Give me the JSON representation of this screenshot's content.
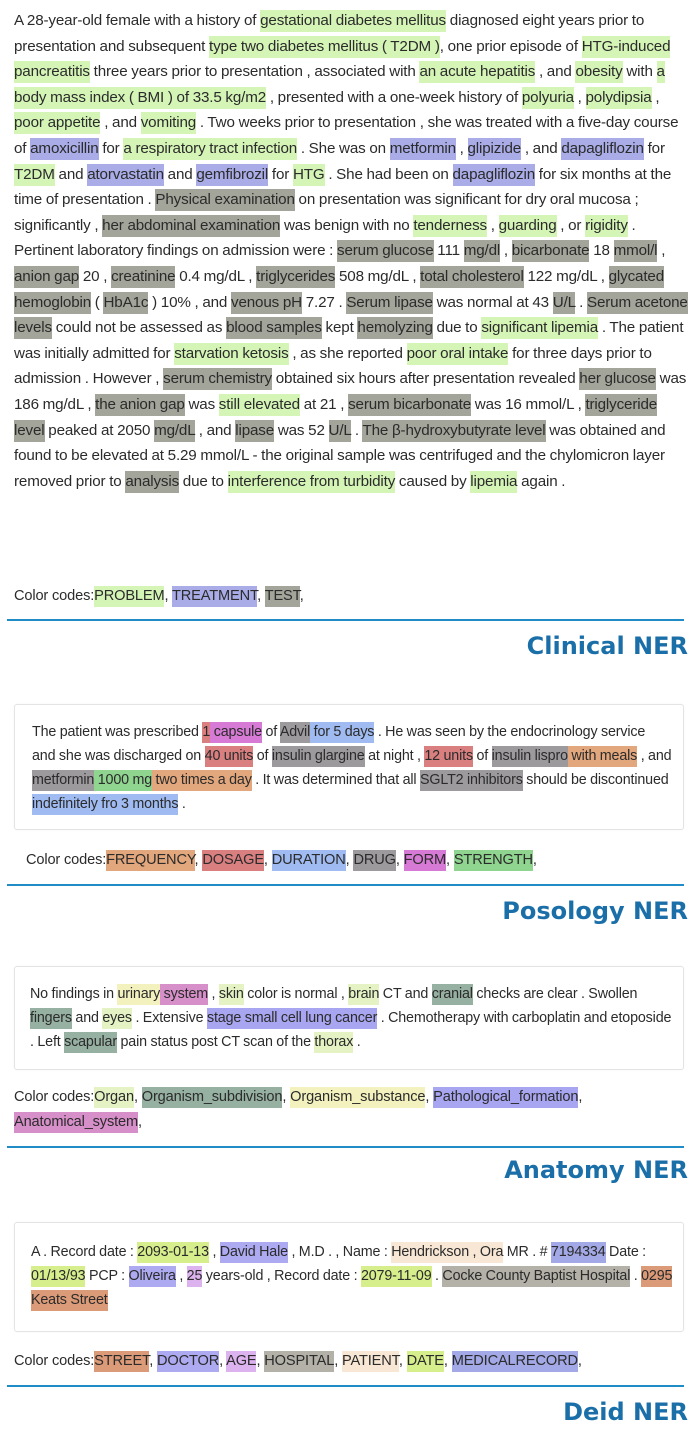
{
  "colors": {
    "PROBLEM": "#d5f5b7",
    "TREATMENT": "#a9ace7",
    "TEST": "#a3a59a",
    "FREQUENCY": "#e2a77c",
    "DOSAGE": "#d97f80",
    "DURATION": "#9fbbf1",
    "DRUG": "#9d9a9e",
    "FORM": "#d67ad5",
    "STRENGTH": "#8fd48f",
    "Organ": "#e5f3c4",
    "Organism_subdivision": "#96b0a2",
    "Organism_substance": "#f3f2bf",
    "Pathological_formation": "#a9a6f1",
    "Anatomical_system": "#d78fc9",
    "STREET": "#dc9b78",
    "DOCTOR": "#aeaaf2",
    "AGE": "#dcb3ee",
    "HOSPITAL": "#b4b1a8",
    "PATIENT": "#f8e7d4",
    "DATE": "#d6ee8c",
    "MEDICALRECORD": "#a2a9e6",
    "rule": "#1f8cc5",
    "title": "#1b6fa8"
  },
  "sections": [
    {
      "id": "clinical",
      "title": "Clinical NER",
      "legend_prefix": "Color codes:",
      "legend": [
        "PROBLEM",
        "TREATMENT",
        "TEST"
      ],
      "tokens": [
        [
          "A 28-year-old female with a history of ",
          null
        ],
        [
          "gestational diabetes mellitus",
          "PROBLEM"
        ],
        [
          " diagnosed eight years prior to presentation and subsequent ",
          null
        ],
        [
          "type two diabetes mellitus ( T2DM )",
          "PROBLEM"
        ],
        [
          ", one prior episode of ",
          null
        ],
        [
          "HTG-induced pancreatitis",
          "PROBLEM"
        ],
        [
          " three years prior to presentation , associated with ",
          null
        ],
        [
          "an acute hepatitis",
          "PROBLEM"
        ],
        [
          " , and ",
          null
        ],
        [
          "obesity",
          "PROBLEM"
        ],
        [
          " with ",
          null
        ],
        [
          "a body mass index ( BMI ) of 33.5 kg/m2",
          "PROBLEM"
        ],
        [
          " , presented with a one-week history of ",
          null
        ],
        [
          "polyuria",
          "PROBLEM"
        ],
        [
          " , ",
          null
        ],
        [
          "polydipsia",
          "PROBLEM"
        ],
        [
          " , ",
          null
        ],
        [
          "poor appetite",
          "PROBLEM"
        ],
        [
          " , and ",
          null
        ],
        [
          "vomiting",
          "PROBLEM"
        ],
        [
          " . Two weeks prior to presentation , she was treated with a five-day course of ",
          null
        ],
        [
          "amoxicillin",
          "TREATMENT"
        ],
        [
          " for ",
          null
        ],
        [
          "a respiratory tract infection",
          "PROBLEM"
        ],
        [
          " . She was on ",
          null
        ],
        [
          "metformin",
          "TREATMENT"
        ],
        [
          " , ",
          null
        ],
        [
          "glipizide",
          "TREATMENT"
        ],
        [
          " , and ",
          null
        ],
        [
          "dapagliflozin",
          "TREATMENT"
        ],
        [
          " for ",
          null
        ],
        [
          "T2DM",
          "PROBLEM"
        ],
        [
          " and ",
          null
        ],
        [
          "atorvastatin",
          "TREATMENT"
        ],
        [
          " and ",
          null
        ],
        [
          "gemfibrozil",
          "TREATMENT"
        ],
        [
          " for ",
          null
        ],
        [
          "HTG",
          "PROBLEM"
        ],
        [
          " . She had been on ",
          null
        ],
        [
          "dapagliflozin",
          "TREATMENT"
        ],
        [
          " for six months at the time of presentation . ",
          null
        ],
        [
          "Physical examination",
          "TEST"
        ],
        [
          " on presentation was significant for dry oral mucosa ; significantly , ",
          null
        ],
        [
          "her abdominal examination",
          "TEST"
        ],
        [
          " was benign with no ",
          null
        ],
        [
          "tenderness",
          "PROBLEM"
        ],
        [
          " , ",
          null
        ],
        [
          "guarding",
          "PROBLEM"
        ],
        [
          " , or ",
          null
        ],
        [
          "rigidity",
          "PROBLEM"
        ],
        [
          " . Pertinent laboratory findings on admission were : ",
          null
        ],
        [
          "serum glucose",
          "TEST"
        ],
        [
          " 111 ",
          null
        ],
        [
          "mg/dl",
          "TEST"
        ],
        [
          " , ",
          null
        ],
        [
          "bicarbonate",
          "TEST"
        ],
        [
          " 18 ",
          null
        ],
        [
          "mmol/l",
          "TEST"
        ],
        [
          " , ",
          null
        ],
        [
          "anion gap",
          "TEST"
        ],
        [
          " 20 , ",
          null
        ],
        [
          "creatinine",
          "TEST"
        ],
        [
          " 0.4 mg/dL , ",
          null
        ],
        [
          "triglycerides",
          "TEST"
        ],
        [
          " 508 mg/dL , ",
          null
        ],
        [
          "total cholesterol",
          "TEST"
        ],
        [
          " 122 mg/dL , ",
          null
        ],
        [
          "glycated hemoglobin",
          "TEST"
        ],
        [
          " ( ",
          null
        ],
        [
          "HbA1c",
          "TEST"
        ],
        [
          " ) 10% , and ",
          null
        ],
        [
          "venous pH",
          "TEST"
        ],
        [
          " 7.27 . ",
          null
        ],
        [
          "Serum lipase",
          "TEST"
        ],
        [
          " was normal at 43 ",
          null
        ],
        [
          "U/L",
          "TEST"
        ],
        [
          " . ",
          null
        ],
        [
          "Serum acetone levels",
          "TEST"
        ],
        [
          " could not be assessed as ",
          null
        ],
        [
          "blood samples",
          "TEST"
        ],
        [
          " kept ",
          null
        ],
        [
          "hemolyzing",
          "TEST"
        ],
        [
          " due to ",
          null
        ],
        [
          "significant lipemia",
          "PROBLEM"
        ],
        [
          " . The patient was initially admitted for ",
          null
        ],
        [
          "starvation ketosis",
          "PROBLEM"
        ],
        [
          " , as she reported ",
          null
        ],
        [
          "poor oral intake",
          "PROBLEM"
        ],
        [
          " for three days prior to admission . However , ",
          null
        ],
        [
          "serum chemistry",
          "TEST"
        ],
        [
          " obtained six hours after presentation revealed ",
          null
        ],
        [
          "her glucose",
          "TEST"
        ],
        [
          " was 186 mg/dL , ",
          null
        ],
        [
          "the anion gap",
          "TEST"
        ],
        [
          " was ",
          null
        ],
        [
          "still elevated",
          "PROBLEM"
        ],
        [
          " at 21 , ",
          null
        ],
        [
          "serum bicarbonate",
          "TEST"
        ],
        [
          " was 16 mmol/L , ",
          null
        ],
        [
          "triglyceride level",
          "TEST"
        ],
        [
          " peaked at 2050 ",
          null
        ],
        [
          "mg/dL",
          "TEST"
        ],
        [
          " , and ",
          null
        ],
        [
          "lipase",
          "TEST"
        ],
        [
          " was 52 ",
          null
        ],
        [
          "U/L",
          "TEST"
        ],
        [
          " . ",
          null
        ],
        [
          "The β-hydroxybutyrate level",
          "TEST"
        ],
        [
          " was obtained and found to be elevated at 5.29 mmol/L - the original sample was centrifuged and the chylomicron layer removed prior to ",
          null
        ],
        [
          "analysis",
          "TEST"
        ],
        [
          " due to ",
          null
        ],
        [
          "interference from turbidity",
          "PROBLEM"
        ],
        [
          " caused by ",
          null
        ],
        [
          "lipemia",
          "PROBLEM"
        ],
        [
          " again .",
          null
        ]
      ]
    },
    {
      "id": "posology",
      "title": "Posology NER",
      "legend_prefix": "Color codes:",
      "legend": [
        "FREQUENCY",
        "DOSAGE",
        "DURATION",
        "DRUG",
        "FORM",
        "STRENGTH"
      ],
      "tokens": [
        [
          "The patient was prescribed ",
          null
        ],
        [
          "1",
          "DOSAGE"
        ],
        [
          " capsule",
          "FORM"
        ],
        [
          " of ",
          null
        ],
        [
          "Advil",
          "DRUG"
        ],
        [
          " for 5 days",
          "DURATION"
        ],
        [
          " . He was seen by the endocrinology service and she was discharged on ",
          null
        ],
        [
          "40 units",
          "DOSAGE"
        ],
        [
          " of ",
          null
        ],
        [
          "insulin glargine",
          "DRUG"
        ],
        [
          " at night , ",
          null
        ],
        [
          "12 units",
          "DOSAGE"
        ],
        [
          " of ",
          null
        ],
        [
          "insulin lispro",
          "DRUG"
        ],
        [
          " with meals",
          "FREQUENCY"
        ],
        [
          " , and ",
          null
        ],
        [
          "metformin",
          "DRUG"
        ],
        [
          " 1000 mg",
          "STRENGTH"
        ],
        [
          " two times a day",
          "FREQUENCY"
        ],
        [
          " . It was determined that all ",
          null
        ],
        [
          "SGLT2 inhibitors",
          "DRUG"
        ],
        [
          " should be discontinued ",
          null
        ],
        [
          "indefinitely fro 3 months",
          "DURATION"
        ],
        [
          " .",
          null
        ]
      ]
    },
    {
      "id": "anatomy",
      "title": "Anatomy NER",
      "legend_prefix": "Color codes:",
      "legend": [
        "Organ",
        "Organism_subdivision",
        "Organism_substance",
        "Pathological_formation",
        "Anatomical_system"
      ],
      "tokens": [
        [
          "No findings in ",
          null
        ],
        [
          "urinary",
          "Organism_substance"
        ],
        [
          " system",
          "Anatomical_system"
        ],
        [
          " , ",
          null
        ],
        [
          "skin",
          "Organ"
        ],
        [
          " color is normal , ",
          null
        ],
        [
          "brain",
          "Organ"
        ],
        [
          " CT and ",
          null
        ],
        [
          "cranial",
          "Organism_subdivision"
        ],
        [
          " checks are clear . Swollen ",
          null
        ],
        [
          "fingers",
          "Organism_subdivision"
        ],
        [
          " and ",
          null
        ],
        [
          "eyes",
          "Organ"
        ],
        [
          " . Extensive ",
          null
        ],
        [
          "stage small cell lung cancer",
          "Pathological_formation"
        ],
        [
          " . Chemotherapy with carboplatin and etoposide . Left ",
          null
        ],
        [
          "scapular",
          "Organism_subdivision"
        ],
        [
          " pain status post CT scan of the ",
          null
        ],
        [
          "thorax",
          "Organ"
        ],
        [
          " .",
          null
        ]
      ]
    },
    {
      "id": "deid",
      "title": "Deid NER",
      "legend_prefix": "Color codes:",
      "legend": [
        "STREET",
        "DOCTOR",
        "AGE",
        "HOSPITAL",
        "PATIENT",
        "DATE",
        "MEDICALRECORD"
      ],
      "tokens": [
        [
          "A . Record date : ",
          null
        ],
        [
          "2093-01-13",
          "DATE"
        ],
        [
          " , ",
          null
        ],
        [
          "David Hale",
          "DOCTOR"
        ],
        [
          " , M.D . , Name : ",
          null
        ],
        [
          "Hendrickson , Ora",
          "PATIENT"
        ],
        [
          " MR . # ",
          null
        ],
        [
          "7194334",
          "MEDICALRECORD"
        ],
        [
          " Date : ",
          null
        ],
        [
          "01/13/93",
          "DATE"
        ],
        [
          " PCP : ",
          null
        ],
        [
          "Oliveira",
          "DOCTOR"
        ],
        [
          " , ",
          null
        ],
        [
          "25",
          "AGE"
        ],
        [
          " years-old , Record date : ",
          null
        ],
        [
          "2079-11-09",
          "DATE"
        ],
        [
          " . ",
          null
        ],
        [
          "Cocke County Baptist Hospital",
          "HOSPITAL"
        ],
        [
          " . ",
          null
        ],
        [
          "0295 Keats Street",
          "STREET"
        ]
      ]
    }
  ]
}
